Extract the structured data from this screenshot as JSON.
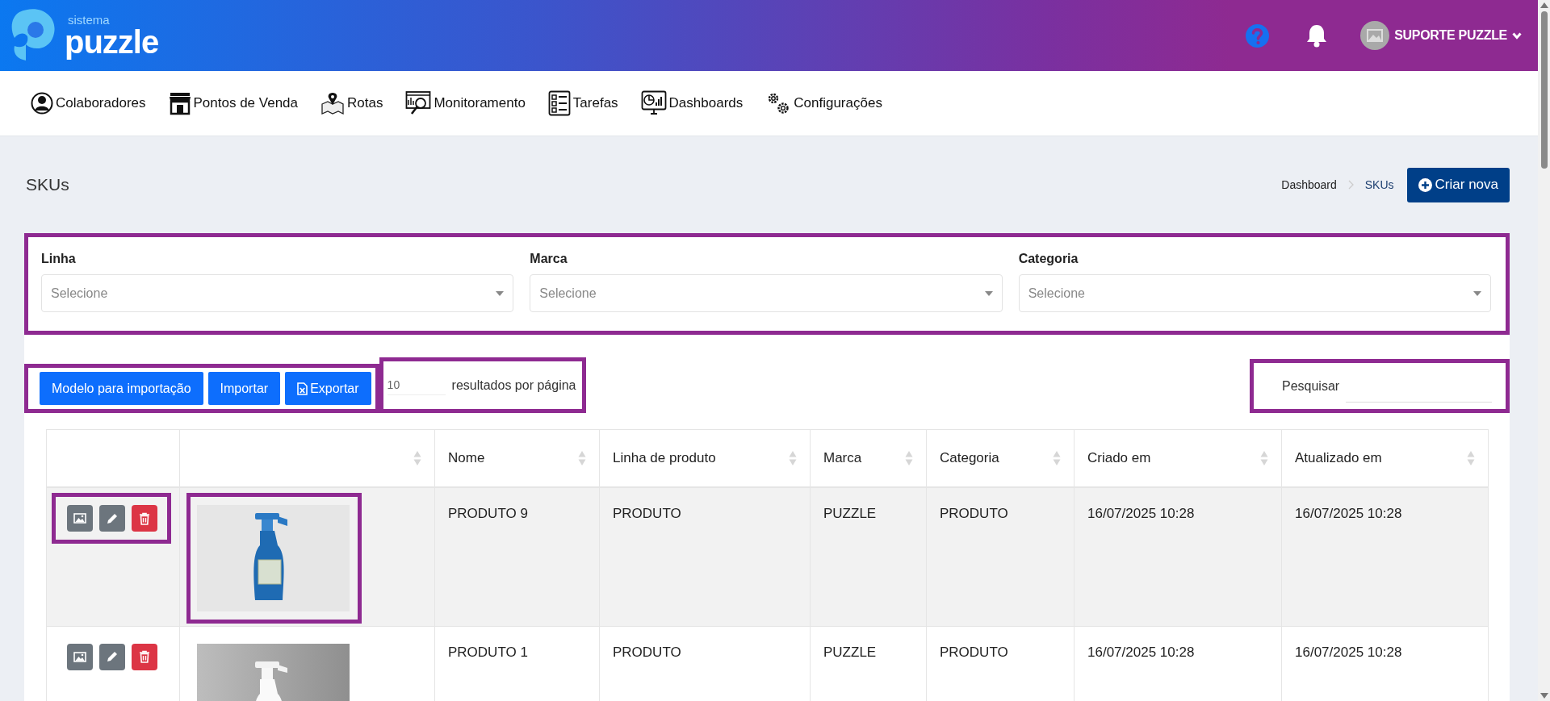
{
  "header": {
    "logo_small": "sistema",
    "logo_large": "puzzle",
    "user_name": "SUPORTE PUZZLE"
  },
  "nav": [
    {
      "label": "Colaboradores",
      "kind": "person"
    },
    {
      "label": "Pontos de Venda",
      "kind": "store"
    },
    {
      "label": "Rotas",
      "kind": "map"
    },
    {
      "label": "Monitoramento",
      "kind": "monitor"
    },
    {
      "label": "Tarefas",
      "kind": "tasks"
    },
    {
      "label": "Dashboards",
      "kind": "dashboard"
    },
    {
      "label": "Configurações",
      "kind": "gears"
    }
  ],
  "page_title": "SKUs",
  "breadcrumb": [
    "Dashboard",
    "SKUs"
  ],
  "create_button": "Criar nova",
  "filters": {
    "highlighted": true,
    "fields": [
      {
        "label": "Linha",
        "placeholder": "Selecione"
      },
      {
        "label": "Marca",
        "placeholder": "Selecione"
      },
      {
        "label": "Categoria",
        "placeholder": "Selecione"
      }
    ]
  },
  "toolbar": {
    "highlighted": true,
    "buttons": [
      {
        "label": "Modelo para importação",
        "kind": "plain"
      },
      {
        "label": "Importar",
        "kind": "plain"
      },
      {
        "label": "Exportar",
        "kind": "excel"
      }
    ]
  },
  "page_size": {
    "highlighted": true,
    "value": "10",
    "label": "resultados por página"
  },
  "search": {
    "highlighted": true,
    "label": "Pesquisar"
  },
  "table": {
    "columns": [
      {
        "sortable": false
      },
      {
        "sortable": true
      },
      {
        "label": "Nome",
        "sortable": true
      },
      {
        "label": "Linha de produto",
        "sortable": true
      },
      {
        "label": "Marca",
        "sortable": true
      },
      {
        "label": "Categoria",
        "sortable": true
      },
      {
        "label": "Criado em",
        "sortable": true
      },
      {
        "label": "Atualizado em",
        "sortable": true
      }
    ],
    "rows": [
      {
        "shaded": true,
        "actions_highlighted": true,
        "image_highlighted": true,
        "cells": [
          "",
          "",
          "PRODUTO 9",
          "PRODUTO",
          "PUZZLE",
          "PRODUTO",
          "16/07/2025 10:28",
          "16/07/2025 10:28"
        ]
      },
      {
        "shaded": false,
        "actions_highlighted": false,
        "image_highlighted": false,
        "cells": [
          "",
          "",
          "PRODUTO 1",
          "PRODUTO",
          "PUZZLE",
          "PRODUTO",
          "16/07/2025 10:28",
          "16/07/2025 10:28"
        ]
      }
    ]
  }
}
